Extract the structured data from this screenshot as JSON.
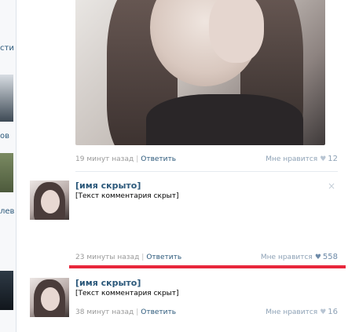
{
  "sidebar": {
    "fragments": [
      "сти",
      "ов",
      "лев"
    ]
  },
  "post": {
    "time": "19 минут назад",
    "reply_label": "Ответить",
    "like_label": "Мне нравится",
    "like_count": "12"
  },
  "comments": [
    {
      "author": "[имя скрыто]",
      "text": "[Текст комментария скрыт]",
      "time": "23 минуты назад",
      "reply_label": "Ответить",
      "like_label": "Мне нравится",
      "like_count": "558",
      "close_icon": "×"
    },
    {
      "author": "[имя скрыто]",
      "text": "[Текст комментария скрыт]",
      "time": "38 минут назад",
      "reply_label": "Ответить",
      "like_label": "Мне нравится",
      "like_count": "16"
    }
  ],
  "colors": {
    "link": "#2b587a",
    "muted": "#999999",
    "highlight": "#e8273c"
  },
  "icons": {
    "like": "heart-icon",
    "close": "close-icon"
  }
}
